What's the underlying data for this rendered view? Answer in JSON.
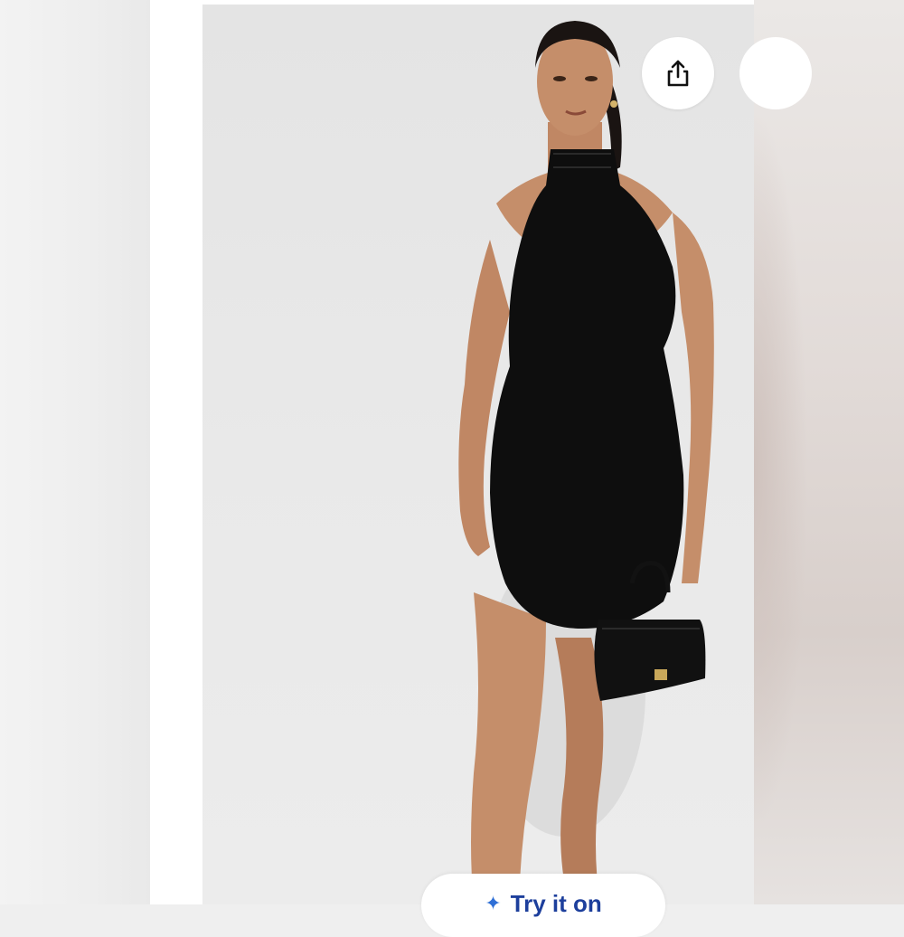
{
  "app": {
    "share_icon": "share-icon",
    "more_icon": "more-icon",
    "sparkle_icon": "sparkle-icon"
  },
  "bottom_bar": {
    "label": "Try it on"
  },
  "colors": {
    "dress": "#0e0e0e",
    "skin": "#c58e6a",
    "background": "#e8e8e8",
    "accent": "#1d3f9c"
  }
}
